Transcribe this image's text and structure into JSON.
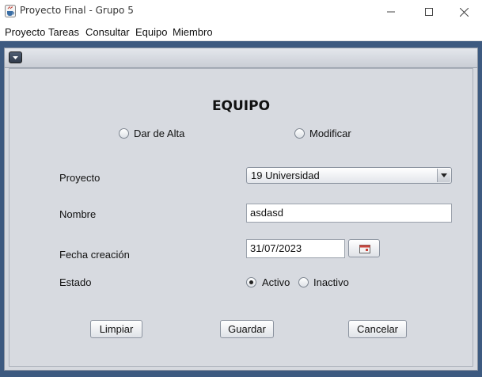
{
  "window": {
    "title": "Proyecto Final - Grupo 5",
    "icon": "java-coffee-icon"
  },
  "menubar": {
    "items": [
      "Proyecto",
      "Tareas",
      "Consultar",
      "Equipo",
      "Miembro"
    ]
  },
  "form": {
    "heading": "EQUIPO",
    "mode_options": [
      {
        "label": "Dar de Alta",
        "selected": false
      },
      {
        "label": "Modificar",
        "selected": false
      }
    ],
    "proyecto": {
      "label": "Proyecto",
      "value": "19 Universidad"
    },
    "nombre": {
      "label": "Nombre",
      "value": "asdasd"
    },
    "fecha": {
      "label": "Fecha creación",
      "value": "31/07/2023",
      "picker_icon": "calendar-icon"
    },
    "estado": {
      "label": "Estado",
      "options": [
        {
          "label": "Activo",
          "selected": true
        },
        {
          "label": "Inactivo",
          "selected": false
        }
      ]
    },
    "buttons": {
      "limpiar": "Limpiar",
      "guardar": "Guardar",
      "cancelar": "Cancelar"
    }
  },
  "colors": {
    "desktop": "#3d5a80",
    "panel": "#d7dae0"
  }
}
